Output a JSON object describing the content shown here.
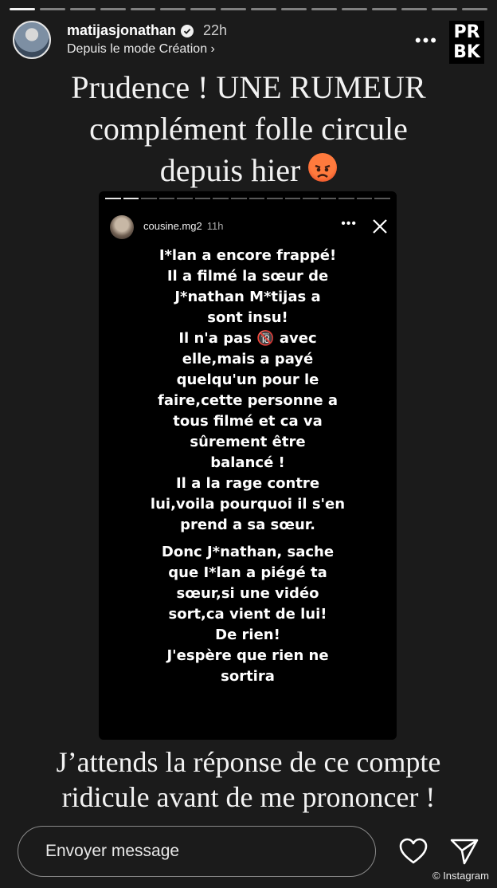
{
  "story": {
    "progress_segments": 16,
    "progress_done": 1,
    "username": "matijasjonathan",
    "time": "22h",
    "subline": "Depuis le mode Création",
    "more": "•••",
    "logo_line1": "PR",
    "logo_line2": "BK",
    "headline": [
      "Prudence ! UNE RUMEUR",
      "complément folle circule",
      "depuis hier"
    ],
    "caption": [
      "J’attends la réponse de ce compte",
      "ridicule avant de me prononcer !"
    ]
  },
  "inner_story": {
    "username": "cousine.mg2",
    "time": "11h",
    "more": "•••",
    "paragraph1": "I*lan a encore frappé!\nIl a filmé la sœur de\nJ*nathan M*tijas a\nsont insu!\nIl n'a pas 🔞 avec\nelle,mais a payé\nquelqu'un pour le\nfaire,cette personne a\ntous filmé et ca va\nsûrement être\nbalancé !\nIl a la rage contre\nlui,voila pourquoi il s'en\nprend a sa sœur.",
    "paragraph2": "Donc J*nathan, sache\nque I*lan a piégé ta\nsœur,si une vidéo\nsort,ca vient de lui!\nDe rien!\nJ'espère que rien ne\nsortira"
  },
  "footer": {
    "message_placeholder": "Envoyer message",
    "credit": "© Instagram"
  },
  "colors": {
    "background": "#1b1b1b",
    "inner_background": "#000000",
    "verified": "#3897f0"
  }
}
